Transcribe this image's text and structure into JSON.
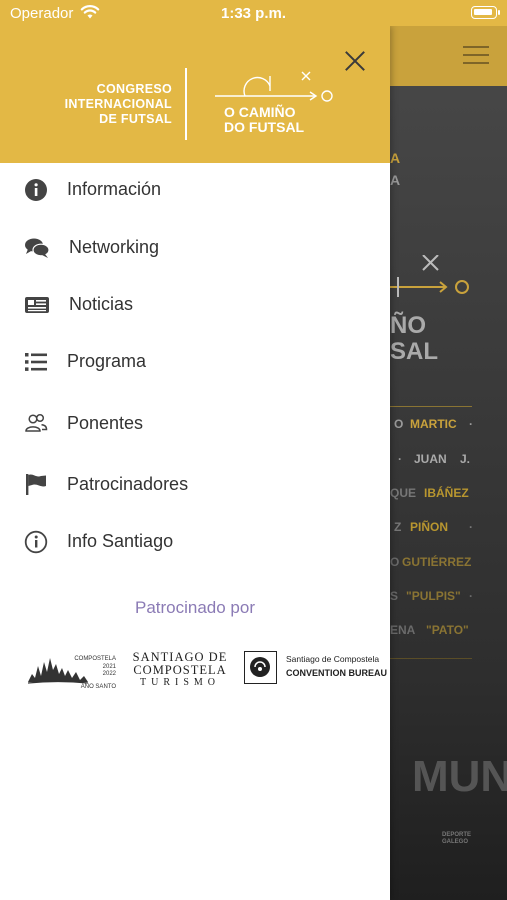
{
  "status_bar": {
    "carrier": "Operador",
    "time": "1:33 p.m."
  },
  "header": {
    "logo_left_lines": [
      "CONGRESO",
      "INTERNACIONAL",
      "DE FUTSAL"
    ],
    "logo_right_lines": [
      "O CAMIÑO",
      "DO FUTSAL"
    ]
  },
  "menu": {
    "items": [
      {
        "label": "Información",
        "icon": "info-circle-icon"
      },
      {
        "label": "Networking",
        "icon": "chat-bubbles-icon"
      },
      {
        "label": "Noticias",
        "icon": "newspaper-icon"
      },
      {
        "label": "Programa",
        "icon": "list-icon"
      },
      {
        "label": "Ponentes",
        "icon": "users-icon"
      },
      {
        "label": "Patrocinadores",
        "icon": "flag-icon"
      },
      {
        "label": "Info Santiago",
        "icon": "info-outline-icon"
      }
    ]
  },
  "sponsors": {
    "title": "Patrocinado por",
    "compostela": {
      "name": "COMPOSTELA",
      "years": [
        "2021",
        "2022"
      ],
      "subtitle": "AÑO SANTO"
    },
    "santiago_turismo": {
      "lines": [
        "SANTIAGO DE",
        "COMPOSTELA",
        "TURISMO"
      ]
    },
    "convention": {
      "line1": "Santiago de Compostela",
      "line2": "CONVENTION BUREAU"
    }
  },
  "background": {
    "fragments": [
      "A",
      "A",
      "ÑO",
      "SAL",
      "O",
      "MARTIC",
      "·",
      "·",
      "JUAN",
      "J.",
      "QUE",
      "IBÁÑEZ",
      "Z",
      "PIÑON",
      "·",
      "O",
      "GUTIÉRREZ",
      "S",
      "\"PULPIS\"",
      "·",
      "ENA",
      "\"PATO\"",
      "MUN",
      "DEPORTE",
      "GALEGO"
    ]
  },
  "colors": {
    "accent": "#e3b845",
    "sponsor_title": "#8b7bb5",
    "menu_text": "#333333"
  }
}
